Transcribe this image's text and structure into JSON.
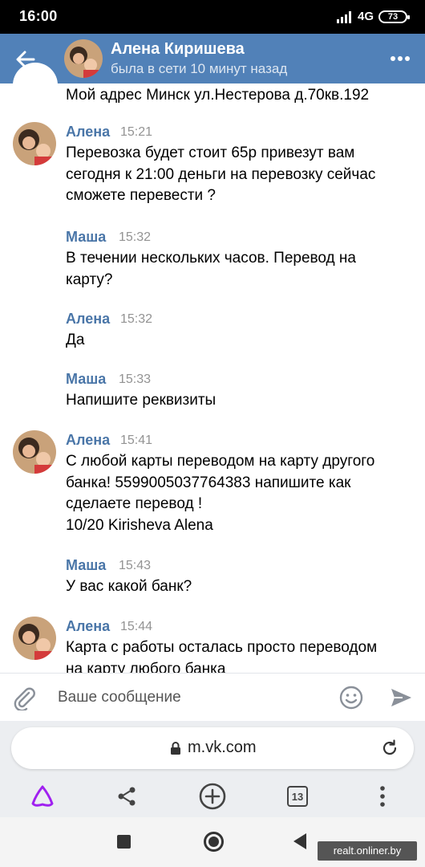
{
  "status_bar": {
    "time": "16:00",
    "network": "4G",
    "battery": "73"
  },
  "header": {
    "title": "Алена Киришева",
    "subtitle": "была в сети 10 минут назад"
  },
  "messages": {
    "top_line": "Мой адрес Минск ул.Нестерова д.70кв.192",
    "items": [
      {
        "author": "Алена",
        "time": "15:21",
        "text": "Перевозка будет стоит 65р привезут вам\nсегодня к 21:00 деньги на перевозку сейчас\nсможете перевести ?"
      },
      {
        "author": "Маша",
        "time": "15:32",
        "text": "В течении нескольких часов. Перевод на\nкарту?"
      },
      {
        "author": "Алена",
        "time": "15:32",
        "text": "Да"
      },
      {
        "author": "Маша",
        "time": "15:33",
        "text": "Напишите реквизиты"
      },
      {
        "author": "Алена",
        "time": "15:41",
        "text": "С любой карты переводом на карту другого\nбанка! 5599005037764383 напишите как\nсделаете перевод !\n10/20 Kirisheva Alena"
      },
      {
        "author": "Маша",
        "time": "15:43",
        "text": "У вас какой банк?"
      },
      {
        "author": "Алена",
        "time": "15:44",
        "text": "Карта с работы осталась просто переводом\nна карту любого банка"
      }
    ]
  },
  "input": {
    "placeholder": "Ваше сообщение"
  },
  "browser": {
    "url": "m.vk.com",
    "tabs_count": "13"
  },
  "watermark": "realt.onliner.by",
  "colors": {
    "header": "#5181b8",
    "author": "#4a76a8",
    "time": "#939393"
  }
}
